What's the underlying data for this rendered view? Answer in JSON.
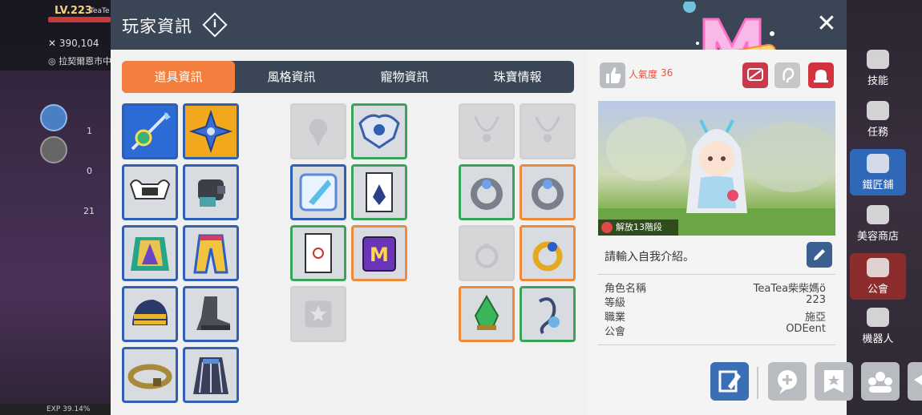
{
  "hud": {
    "level": "LV.223",
    "name": "TeaTe",
    "gold": "390,104",
    "map": "拉契爾恩市中",
    "counter1": "1",
    "counter2": "0",
    "counter3": "21",
    "exp": "EXP 39.14%"
  },
  "dialog": {
    "title": "玩家資訊",
    "close_label": "✕"
  },
  "tabs": [
    {
      "label": "道具資訊",
      "active": true
    },
    {
      "label": "風格資訊",
      "active": false
    },
    {
      "label": "寵物資訊",
      "active": false
    },
    {
      "label": "珠寶情報",
      "active": false
    }
  ],
  "equipment": {
    "column1": [
      {
        "item": "staff-weapon",
        "border": "blue"
      },
      {
        "item": "shuriken-secondary",
        "border": "blue"
      },
      {
        "item": "winged-headband",
        "border": "blue"
      },
      {
        "item": "gauntlet-glove",
        "border": "blue"
      },
      {
        "item": "emerald-cape",
        "border": "blue"
      },
      {
        "item": "rainbow-pants",
        "border": "blue"
      },
      {
        "item": "gold-hat",
        "border": "blue"
      },
      {
        "item": "steel-boots",
        "border": "blue"
      },
      {
        "item": "gold-belt",
        "border": "blue"
      },
      {
        "item": "striped-overall",
        "border": "blue"
      }
    ],
    "column2": [
      {
        "item": "empty-medal",
        "border": "empty"
      },
      {
        "item": "silver-emblem",
        "border": "green"
      },
      {
        "item": "ice-badge",
        "border": "blue"
      },
      {
        "item": "blue-gem-card",
        "border": "green"
      },
      {
        "item": "red-tag-card",
        "border": "green"
      },
      {
        "item": "m-notebook",
        "border": "orange"
      },
      {
        "item": "empty-star",
        "border": "empty"
      }
    ],
    "column3": [
      {
        "item": "empty-necklace",
        "border": "empty"
      },
      {
        "item": "empty-necklace",
        "border": "empty"
      },
      {
        "item": "silver-ring-blue",
        "border": "green"
      },
      {
        "item": "silver-ring-orange",
        "border": "orange"
      },
      {
        "item": "empty-ring",
        "border": "empty"
      },
      {
        "item": "gold-sapphire-ring",
        "border": "orange"
      },
      {
        "item": "green-crystal",
        "border": "orange"
      },
      {
        "item": "silver-earring",
        "border": "green"
      }
    ]
  },
  "profile": {
    "popularity_label": "人氣度",
    "popularity_value": "36",
    "unlock_label": "解放13階段",
    "intro_placeholder": "請輸入自我介紹。",
    "fields": [
      {
        "key": "角色名稱",
        "value": "TeaTea柴柴媽ö"
      },
      {
        "key": "等級",
        "value": "223"
      },
      {
        "key": "職業",
        "value": "施亞"
      },
      {
        "key": "公會",
        "value": "ODEent"
      }
    ]
  },
  "sidebar": {
    "items": [
      {
        "label": "技能"
      },
      {
        "label": "任務"
      },
      {
        "label": "鐵匠鋪"
      },
      {
        "label": "美容商店"
      },
      {
        "label": "公會"
      },
      {
        "label": "機器人"
      }
    ]
  },
  "colors": {
    "header_bg": "#3a4556",
    "tab_active": "#f27f3d",
    "border_blue": "#2f5fb3",
    "border_green": "#3aa35a",
    "border_orange": "#ef8a3a",
    "popularity": "#e2553f"
  }
}
